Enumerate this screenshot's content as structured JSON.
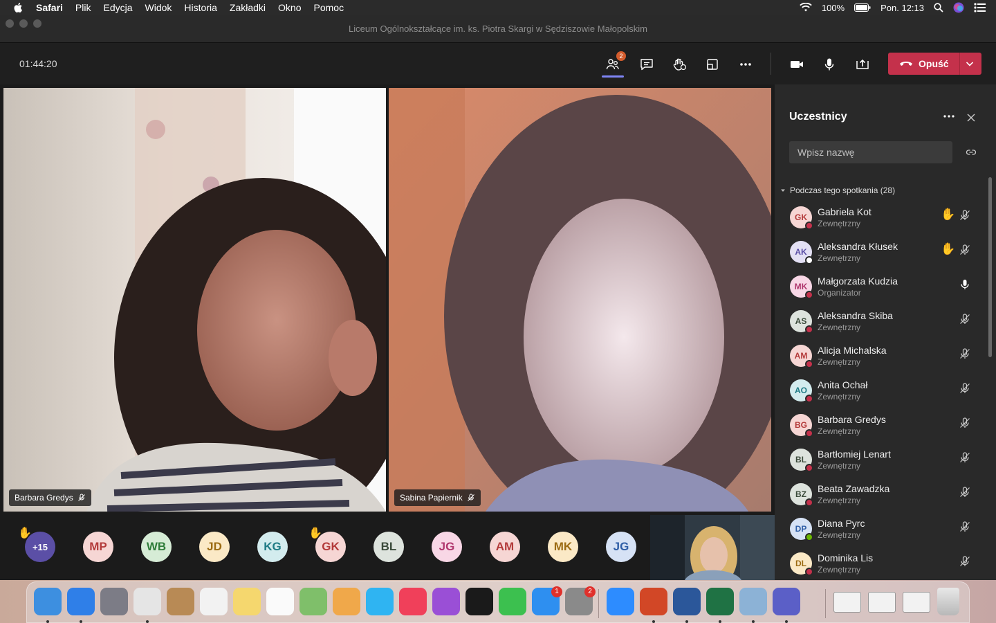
{
  "menubar": {
    "items": [
      "Safari",
      "Plik",
      "Edycja",
      "Widok",
      "Historia",
      "Zakładki",
      "Okno",
      "Pomoc"
    ],
    "battery": "100%",
    "clock": "Pon. 12:13"
  },
  "window": {
    "title": "Liceum Ogólnokształcące im. ks. Piotra Skargi w Sędziszowie Małopolskim"
  },
  "toolbar": {
    "timer": "01:44:20",
    "participants_badge": "2",
    "leave_label": "Opuść"
  },
  "videos": [
    {
      "name": "Barbara Gredys"
    },
    {
      "name": "Sabina Papiernik"
    }
  ],
  "avatars_row": [
    {
      "initials": "+15",
      "bg": "#5b4fa6",
      "fg": "#ffffff",
      "hand": true
    },
    {
      "initials": "MP",
      "bg": "#f6d6d4",
      "fg": "#b33a3a",
      "hand": false
    },
    {
      "initials": "WB",
      "bg": "#d6ecd6",
      "fg": "#2f7d3a",
      "hand": false
    },
    {
      "initials": "JD",
      "bg": "#fbe9c6",
      "fg": "#9c6b12",
      "hand": false
    },
    {
      "initials": "KG",
      "bg": "#d3ecee",
      "fg": "#1f7b85",
      "hand": false
    },
    {
      "initials": "GK",
      "bg": "#f6d6d4",
      "fg": "#b33a3a",
      "hand": true
    },
    {
      "initials": "BL",
      "bg": "#dde3dd",
      "fg": "#3b4b3b",
      "hand": false
    },
    {
      "initials": "JG",
      "bg": "#f8d7e6",
      "fg": "#b0376e",
      "hand": false
    },
    {
      "initials": "AM",
      "bg": "#f6d6d4",
      "fg": "#b33a3a",
      "hand": false
    },
    {
      "initials": "MK",
      "bg": "#fbe9c6",
      "fg": "#9c6b12",
      "hand": false
    },
    {
      "initials": "JG",
      "bg": "#d6e2f5",
      "fg": "#2f5ea6",
      "hand": false
    }
  ],
  "panel": {
    "title": "Uczestnicy",
    "search_placeholder": "Wpisz nazwę",
    "section_label": "Podczas tego spotkania (28)",
    "participants": [
      {
        "initials": "GK",
        "name": "Gabriela Kot",
        "role": "Zewnętrzny",
        "bg": "#f6d6d4",
        "fg": "#b33a3a",
        "status": "#c4314b",
        "hand": true,
        "mic": "muted"
      },
      {
        "initials": "AK",
        "name": "Aleksandra Kłusek",
        "role": "Zewnętrzny",
        "bg": "#e3e0f4",
        "fg": "#5b4fa6",
        "status": "#ffffff",
        "hand": true,
        "mic": "muted"
      },
      {
        "initials": "MK",
        "name": "Małgorzata Kudzia",
        "role": "Organizator",
        "bg": "#f8d7e6",
        "fg": "#b0376e",
        "status": "#c4314b",
        "hand": false,
        "mic": "on"
      },
      {
        "initials": "AS",
        "name": "Aleksandra Skiba",
        "role": "Zewnętrzny",
        "bg": "#dde3dd",
        "fg": "#3b4b3b",
        "status": "#c4314b",
        "hand": false,
        "mic": "muted"
      },
      {
        "initials": "AM",
        "name": "Alicja Michalska",
        "role": "Zewnętrzny",
        "bg": "#f6d6d4",
        "fg": "#b33a3a",
        "status": "#c4314b",
        "hand": false,
        "mic": "muted"
      },
      {
        "initials": "AO",
        "name": "Anita Ochał",
        "role": "Zewnętrzny",
        "bg": "#d3ecee",
        "fg": "#1f7b85",
        "status": "#c4314b",
        "hand": false,
        "mic": "muted"
      },
      {
        "initials": "BG",
        "name": "Barbara Gredys",
        "role": "Zewnętrzny",
        "bg": "#f6d6d4",
        "fg": "#b33a3a",
        "status": "#c4314b",
        "hand": false,
        "mic": "muted"
      },
      {
        "initials": "BL",
        "name": "Bartłomiej Lenart",
        "role": "Zewnętrzny",
        "bg": "#dde3dd",
        "fg": "#3b4b3b",
        "status": "#c4314b",
        "hand": false,
        "mic": "muted"
      },
      {
        "initials": "BZ",
        "name": "Beata Zawadzka",
        "role": "Zewnętrzny",
        "bg": "#dde3dd",
        "fg": "#3b4b3b",
        "status": "#c4314b",
        "hand": false,
        "mic": "muted"
      },
      {
        "initials": "DP",
        "name": "Diana Pyrc",
        "role": "Zewnętrzny",
        "bg": "#d6e2f5",
        "fg": "#2f5ea6",
        "status": "#6bb700",
        "hand": false,
        "mic": "muted"
      },
      {
        "initials": "DL",
        "name": "Dominika Lis",
        "role": "Zewnętrzny",
        "bg": "#fbe9c6",
        "fg": "#9c6b12",
        "status": "#c4314b",
        "hand": false,
        "mic": "muted"
      }
    ]
  },
  "dock": {
    "apps": [
      {
        "name": "finder",
        "color": "#3d8fe0",
        "running": true,
        "badge": ""
      },
      {
        "name": "safari",
        "color": "#2f7fe8",
        "running": true,
        "badge": ""
      },
      {
        "name": "launchpad",
        "color": "#7c7c86",
        "running": false,
        "badge": ""
      },
      {
        "name": "chrome",
        "color": "#e5e5e5",
        "running": true,
        "badge": ""
      },
      {
        "name": "contacts",
        "color": "#b88a55",
        "running": false,
        "badge": ""
      },
      {
        "name": "calendar",
        "color": "#f2f2f2",
        "running": false,
        "badge": ""
      },
      {
        "name": "notes",
        "color": "#f5d76e",
        "running": false,
        "badge": ""
      },
      {
        "name": "reminders",
        "color": "#fafafa",
        "running": false,
        "badge": ""
      },
      {
        "name": "maps",
        "color": "#7fbf6a",
        "running": false,
        "badge": ""
      },
      {
        "name": "photos",
        "color": "#f0a84a",
        "running": false,
        "badge": ""
      },
      {
        "name": "messages",
        "color": "#2fb4f2",
        "running": false,
        "badge": ""
      },
      {
        "name": "music",
        "color": "#f0405a",
        "running": false,
        "badge": ""
      },
      {
        "name": "podcasts",
        "color": "#9a4fd6",
        "running": false,
        "badge": ""
      },
      {
        "name": "tv",
        "color": "#1a1a1a",
        "running": false,
        "badge": ""
      },
      {
        "name": "facetime",
        "color": "#3cc04f",
        "running": false,
        "badge": ""
      },
      {
        "name": "app-store",
        "color": "#2e8ff0",
        "running": false,
        "badge": "1"
      },
      {
        "name": "system-preferences",
        "color": "#8a8a8a",
        "running": false,
        "badge": "2"
      },
      {
        "name": "zoom",
        "color": "#2d8cff",
        "running": false,
        "badge": ""
      },
      {
        "name": "powerpoint",
        "color": "#d24726",
        "running": true,
        "badge": ""
      },
      {
        "name": "word",
        "color": "#2b579a",
        "running": true,
        "badge": ""
      },
      {
        "name": "excel",
        "color": "#1f7244",
        "running": true,
        "badge": ""
      },
      {
        "name": "preview",
        "color": "#8cb2d6",
        "running": true,
        "badge": ""
      },
      {
        "name": "teams",
        "color": "#5b5fc7",
        "running": true,
        "badge": ""
      }
    ],
    "recent": [
      "window-1",
      "window-2",
      "window-3"
    ]
  },
  "colors": {
    "accent": "#7f85f5",
    "leave": "#c4314b",
    "panel_bg": "#292929"
  }
}
